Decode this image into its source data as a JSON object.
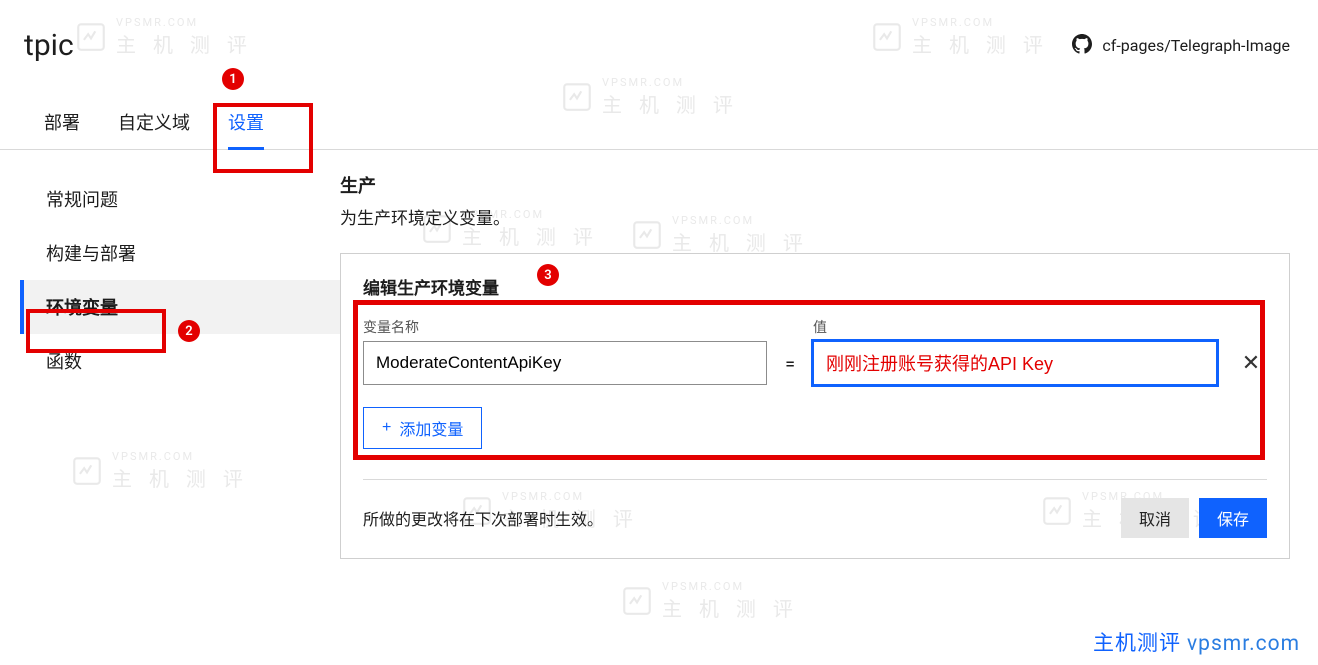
{
  "header": {
    "title": "tpic",
    "repo_label": "cf-pages/Telegraph-Image",
    "repo_icon": "github-icon"
  },
  "tabs": [
    {
      "label": "部署",
      "active": false
    },
    {
      "label": "自定义域",
      "active": false
    },
    {
      "label": "设置",
      "active": true
    }
  ],
  "sidebar": [
    {
      "label": "常规问题",
      "active": false
    },
    {
      "label": "构建与部署",
      "active": false
    },
    {
      "label": "环境变量",
      "active": true
    },
    {
      "label": "函数",
      "active": false
    }
  ],
  "section": {
    "title": "生产",
    "desc": "为生产环境定义变量。"
  },
  "panel": {
    "title": "编辑生产环境变量",
    "name_label": "变量名称",
    "value_label": "值",
    "name_value": "ModerateContentApiKey",
    "value_value": "刚刚注册账号获得的API Key",
    "equals": "=",
    "add_button": "添加变量",
    "add_icon": "+",
    "remove_icon": "✕",
    "note": "所做的更改将在下次部署时生效。",
    "cancel": "取消",
    "save": "保存"
  },
  "annotations": {
    "badge1": "1",
    "badge2": "2",
    "badge3": "3"
  },
  "watermark": {
    "brand": "主机测评",
    "domain": "vpsmr.com",
    "bg_small": "VPSMR.COM",
    "bg_large": "主 机 测 评"
  }
}
